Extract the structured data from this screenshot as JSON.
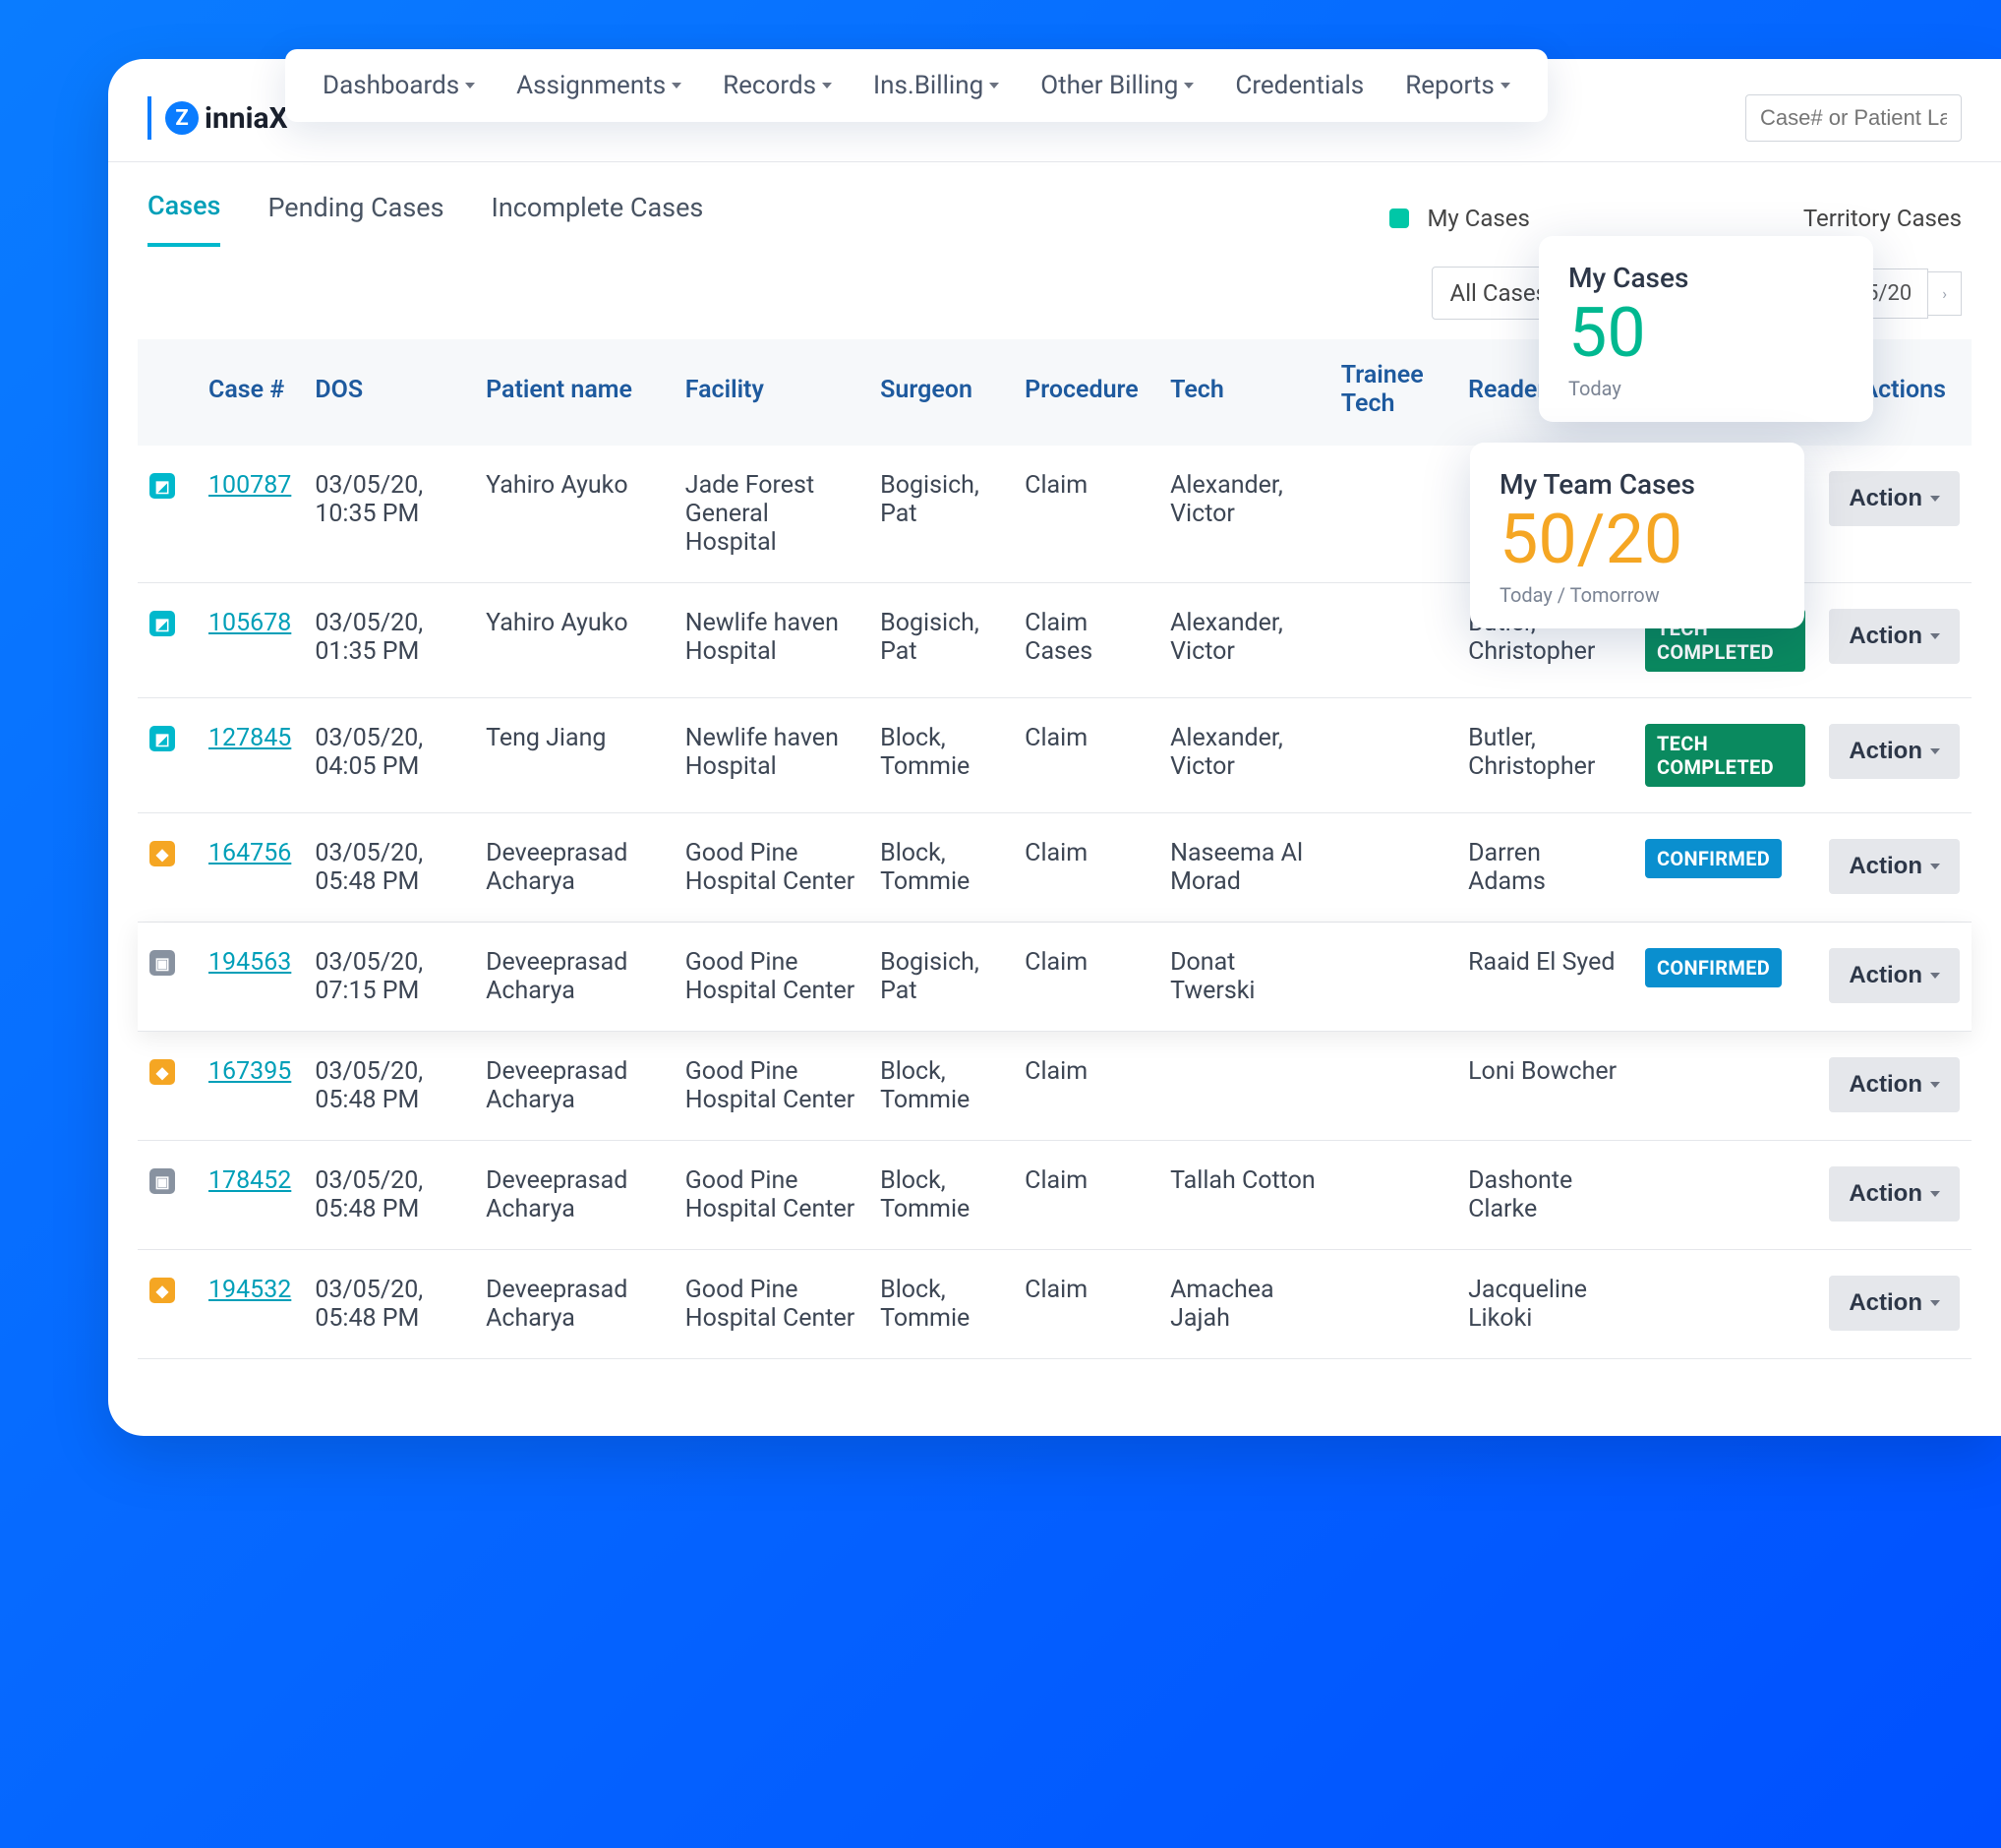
{
  "brand": {
    "initial": "Z",
    "name": "inniaX"
  },
  "search": {
    "placeholder": "Case# or Patient LasNam"
  },
  "topnav": {
    "dashboards": "Dashboards",
    "assignments": "Assignments",
    "records": "Records",
    "insbilling": "Ins.Billing",
    "otherbilling": "Other Billing",
    "credentials": "Credentials",
    "reports": "Reports"
  },
  "subtabs": {
    "cases": "Cases",
    "pending": "Pending Cases",
    "incomplete": "Incomplete Cases"
  },
  "legend": {
    "mycases": "My Cases",
    "territory": "Territory Cases"
  },
  "filter": {
    "allcases": "All Cases",
    "pager_text": "5/20"
  },
  "columns": {
    "caseno": "Case #",
    "dos": "DOS",
    "patient": "Patient name",
    "facility": "Facility",
    "surgeon": "Surgeon",
    "procedure": "Procedure",
    "tech": "Tech",
    "trainee": "Trainee Tech",
    "reader": "Reader",
    "status": "Status",
    "actions": "Actions"
  },
  "action_label": "Action",
  "status_labels": {
    "tech_completed": "TECH COMPLETED",
    "confirmed": "CONFIRMED"
  },
  "rows": [
    {
      "icon": "teal",
      "caseno": "100787",
      "dos": "03/05/20, 10:35 PM",
      "patient": "Yahiro Ayuko",
      "facility": "Jade Forest General Hospital",
      "surgeon": "Bogisich, Pat",
      "procedure": "Claim",
      "tech": "Alexander, Victor",
      "trainee": "",
      "reader": "",
      "status": "",
      "status_kind": ""
    },
    {
      "icon": "teal",
      "caseno": "105678",
      "dos": "03/05/20, 01:35 PM",
      "patient": "Yahiro Ayuko",
      "facility": "Newlife haven Hospital",
      "surgeon": "Bogisich, Pat",
      "procedure": "Claim Cases",
      "tech": "Alexander, Victor",
      "trainee": "",
      "reader": "Butler, Christopher",
      "status": "TECH COMPLETED",
      "status_kind": "tech"
    },
    {
      "icon": "teal",
      "caseno": "127845",
      "dos": "03/05/20, 04:05 PM",
      "patient": "Teng Jiang",
      "facility": "Newlife haven Hospital",
      "surgeon": "Block, Tommie",
      "procedure": "Claim",
      "tech": "Alexander, Victor",
      "trainee": "",
      "reader": "Butler, Christopher",
      "status": "TECH COMPLETED",
      "status_kind": "tech"
    },
    {
      "icon": "orange",
      "caseno": "164756",
      "dos": "03/05/20, 05:48 PM",
      "patient": "Deveeprasad Acharya",
      "facility": "Good Pine Hospital Center",
      "surgeon": "Block, Tommie",
      "procedure": "Claim",
      "tech": "Naseema Al Morad",
      "trainee": "",
      "reader": "Darren Adams",
      "status": "CONFIRMED",
      "status_kind": "conf"
    },
    {
      "icon": "grey",
      "caseno": "194563",
      "dos": "03/05/20, 07:15 PM",
      "patient": "Deveeprasad Acharya",
      "facility": "Good Pine Hospital Center",
      "surgeon": "Bogisich, Pat",
      "procedure": "Claim",
      "tech": "Donat Twerski",
      "trainee": "",
      "reader": "Raaid El Syed",
      "status": "CONFIRMED",
      "status_kind": "conf",
      "highlight": true
    },
    {
      "icon": "orange",
      "caseno": "167395",
      "dos": "03/05/20, 05:48 PM",
      "patient": "Deveeprasad Acharya",
      "facility": "Good Pine Hospital Center",
      "surgeon": "Block, Tommie",
      "procedure": "Claim",
      "tech": "",
      "trainee": "",
      "reader": "Loni Bowcher",
      "status": "",
      "status_kind": ""
    },
    {
      "icon": "grey",
      "caseno": "178452",
      "dos": "03/05/20, 05:48 PM",
      "patient": "Deveeprasad Acharya",
      "facility": "Good Pine Hospital Center",
      "surgeon": "Block, Tommie",
      "procedure": "Claim",
      "tech": "Tallah Cotton",
      "trainee": "",
      "reader": "Dashonte Clarke",
      "status": "",
      "status_kind": ""
    },
    {
      "icon": "orange",
      "caseno": "194532",
      "dos": "03/05/20, 05:48 PM",
      "patient": "Deveeprasad Acharya",
      "facility": "Good Pine Hospital Center",
      "surgeon": "Block, Tommie",
      "procedure": "Claim",
      "tech": "Amachea Jajah",
      "trainee": "",
      "reader": "Jacqueline Likoki",
      "status": "",
      "status_kind": ""
    }
  ],
  "cards": {
    "mycases": {
      "title": "My Cases",
      "value": "50",
      "sub": "Today"
    },
    "myteam": {
      "title": "My Team Cases",
      "value": "50/20",
      "sub": "Today / Tomorrow"
    }
  }
}
